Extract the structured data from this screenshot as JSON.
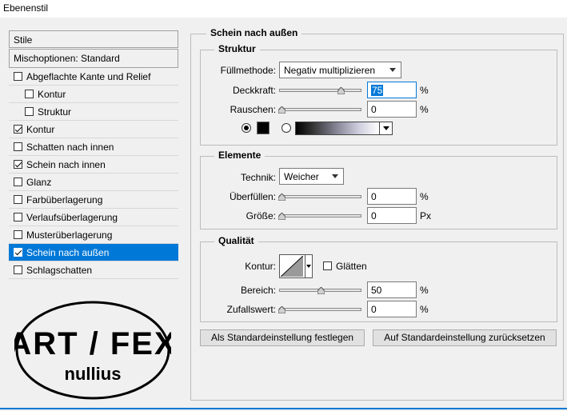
{
  "window": {
    "title": "Ebenenstil"
  },
  "styles": {
    "header": "Stile",
    "blending": "Mischoptionen: Standard",
    "items": [
      {
        "label": "Abgeflachte Kante und Relief",
        "checked": false
      },
      {
        "label": "Kontur",
        "checked": false
      },
      {
        "label": "Struktur",
        "checked": false
      },
      {
        "label": "Kontur",
        "checked": true
      },
      {
        "label": "Schatten nach innen",
        "checked": false
      },
      {
        "label": "Schein nach innen",
        "checked": true
      },
      {
        "label": "Glanz",
        "checked": false
      },
      {
        "label": "Farbüberlagerung",
        "checked": false
      },
      {
        "label": "Verlaufsüberlagerung",
        "checked": false
      },
      {
        "label": "Musterüberlagerung",
        "checked": false
      },
      {
        "label": "Schein nach außen",
        "checked": true,
        "selected": true
      },
      {
        "label": "Schlagschatten",
        "checked": false
      }
    ]
  },
  "logo": {
    "line1": "ART / FEX",
    "line2": "nullius"
  },
  "panel": {
    "title": "Schein nach außen",
    "struktur": {
      "title": "Struktur",
      "blend_label": "Füllmethode:",
      "blend_value": "Negativ multiplizieren",
      "opacity_label": "Deckkraft:",
      "opacity_value": "75",
      "opacity_unit": "%",
      "noise_label": "Rauschen:",
      "noise_value": "0",
      "noise_unit": "%",
      "color_mode": "solid"
    },
    "elemente": {
      "title": "Elemente",
      "technique_label": "Technik:",
      "technique_value": "Weicher",
      "spread_label": "Überfüllen:",
      "spread_value": "0",
      "spread_unit": "%",
      "size_label": "Größe:",
      "size_value": "0",
      "size_unit": "Px"
    },
    "qualitaet": {
      "title": "Qualität",
      "contour_label": "Kontur:",
      "smooth_label": "Glätten",
      "smooth_checked": false,
      "range_label": "Bereich:",
      "range_value": "50",
      "range_unit": "%",
      "jitter_label": "Zufallswert:",
      "jitter_value": "0",
      "jitter_unit": "%"
    },
    "buttons": {
      "set_default": "Als Standardeinstellung festlegen",
      "reset_default": "Auf Standardeinstellung zurücksetzen"
    }
  },
  "colors": {
    "accent": "#0078d7",
    "swatch": "#000000"
  }
}
